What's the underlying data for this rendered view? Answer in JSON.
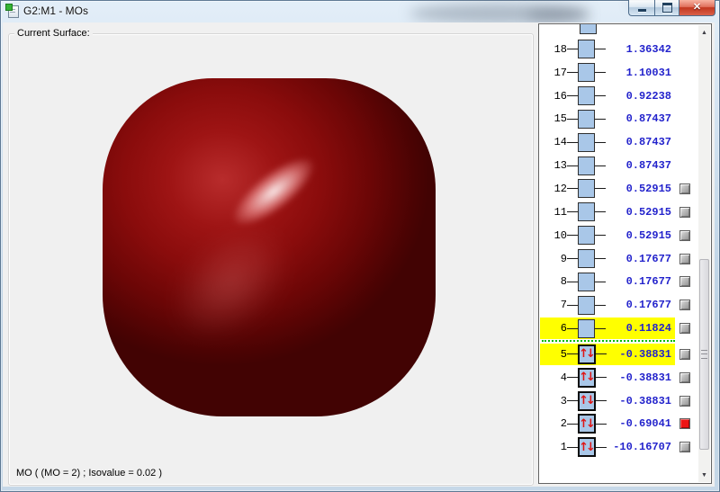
{
  "window": {
    "title": "G2:M1 - MOs"
  },
  "icons": {
    "minimize": "minimize-icon",
    "maximize": "maximize-icon",
    "close_glyph": "✕",
    "scroll_up_glyph": "▲",
    "scroll_down_glyph": "▼",
    "spin_pair_glyph": "↑↓"
  },
  "surface_panel": {
    "label": "Current Surface:",
    "status": "MO ( (MO = 2) ; Isovalue = 0.02 )"
  },
  "mo_list": {
    "selected_mo": 2,
    "highlighted_rows": [
      6,
      5
    ],
    "homo_lumo_separator_between": [
      6,
      5
    ],
    "rows": [
      {
        "n": 18,
        "energy": "1.36342",
        "occupied": false,
        "checkbox": "none",
        "highlight": false
      },
      {
        "n": 17,
        "energy": "1.10031",
        "occupied": false,
        "checkbox": "none",
        "highlight": false
      },
      {
        "n": 16,
        "energy": "0.92238",
        "occupied": false,
        "checkbox": "none",
        "highlight": false
      },
      {
        "n": 15,
        "energy": "0.87437",
        "occupied": false,
        "checkbox": "none",
        "highlight": false
      },
      {
        "n": 14,
        "energy": "0.87437",
        "occupied": false,
        "checkbox": "none",
        "highlight": false
      },
      {
        "n": 13,
        "energy": "0.87437",
        "occupied": false,
        "checkbox": "none",
        "highlight": false
      },
      {
        "n": 12,
        "energy": "0.52915",
        "occupied": false,
        "checkbox": "gray",
        "highlight": false
      },
      {
        "n": 11,
        "energy": "0.52915",
        "occupied": false,
        "checkbox": "gray",
        "highlight": false
      },
      {
        "n": 10,
        "energy": "0.52915",
        "occupied": false,
        "checkbox": "gray",
        "highlight": false
      },
      {
        "n": 9,
        "energy": "0.17677",
        "occupied": false,
        "checkbox": "gray",
        "highlight": false
      },
      {
        "n": 8,
        "energy": "0.17677",
        "occupied": false,
        "checkbox": "gray",
        "highlight": false
      },
      {
        "n": 7,
        "energy": "0.17677",
        "occupied": false,
        "checkbox": "gray",
        "highlight": false
      },
      {
        "n": 6,
        "energy": "0.11824",
        "occupied": false,
        "checkbox": "gray",
        "highlight": true
      },
      {
        "n": 5,
        "energy": "-0.38831",
        "occupied": true,
        "checkbox": "gray",
        "highlight": true,
        "separator_before": true
      },
      {
        "n": 4,
        "energy": "-0.38831",
        "occupied": true,
        "checkbox": "gray",
        "highlight": false
      },
      {
        "n": 3,
        "energy": "-0.38831",
        "occupied": true,
        "checkbox": "gray",
        "highlight": false
      },
      {
        "n": 2,
        "energy": "-0.69041",
        "occupied": true,
        "checkbox": "red",
        "highlight": false
      },
      {
        "n": 1,
        "energy": "-10.16707",
        "occupied": true,
        "checkbox": "gray",
        "highlight": false
      }
    ]
  },
  "colors": {
    "viewport_bg": "#8386cd",
    "surface_red": "#8a0c0c",
    "row_highlight": "#ffff00",
    "energy_text": "#2323cc",
    "homo_lumo_line": "#00bb00",
    "selected_checkbox": "#ee1414",
    "level_box_fill": "#a9c7e8"
  }
}
